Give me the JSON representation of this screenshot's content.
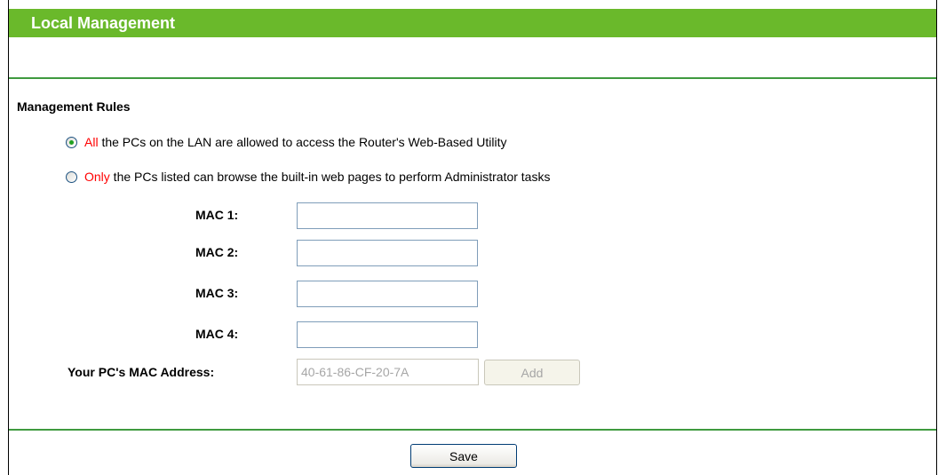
{
  "header": {
    "title": "Local Management",
    "color": "#6ab92b"
  },
  "management_rules": {
    "heading": "Management Rules",
    "options": [
      {
        "highlight": "All",
        "text": " the PCs on the LAN are allowed to access the Router's Web-Based Utility",
        "selected": true
      },
      {
        "highlight": "Only",
        "text": " the PCs listed can browse the built-in web pages to perform Administrator tasks",
        "selected": false
      }
    ]
  },
  "mac_fields": [
    {
      "label": "MAC 1:",
      "value": ""
    },
    {
      "label": "MAC 2:",
      "value": ""
    },
    {
      "label": "MAC 3:",
      "value": ""
    },
    {
      "label": "MAC 4:",
      "value": ""
    }
  ],
  "your_mac": {
    "label": "Your PC's MAC Address:",
    "value": "40-61-86-CF-20-7A",
    "add_label": "Add"
  },
  "actions": {
    "save_label": "Save"
  },
  "colors": {
    "accent_green": "#6ab92b",
    "divider_green": "#3f9a3f",
    "highlight_red": "#ff0000"
  }
}
